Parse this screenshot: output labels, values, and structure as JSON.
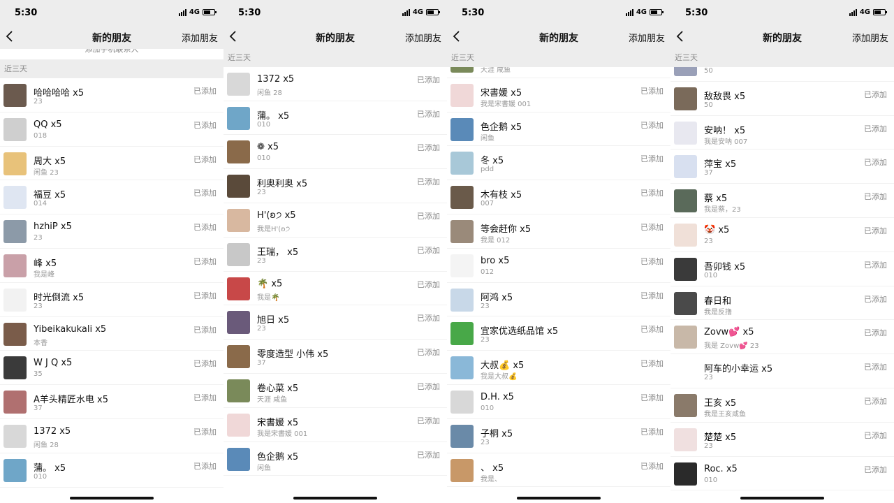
{
  "status_bar": {
    "time": "5:30",
    "network": "4G"
  },
  "nav": {
    "title": "新的朋友",
    "action": "添加朋友"
  },
  "section_label": "近三天",
  "phone_contacts_label": "添加手机联系人",
  "colors": {
    "background": "#ededed",
    "accent": "#07c160",
    "status_text": "#888888"
  },
  "icons": {
    "back": "chevron-left-icon",
    "phone": "phone-icon"
  },
  "panels": [
    {
      "show_phone_card": true,
      "show_sticky_header": false,
      "rows": [
        {
          "name": "哈哈哈哈  x5",
          "sub": "23",
          "status": "已添加",
          "avatar": "#6b5a4e"
        },
        {
          "name": "QQ  x5",
          "sub": "018",
          "status": "已添加",
          "avatar": "#cfcfcf"
        },
        {
          "name": "周大  x5",
          "sub": "闲鱼 23",
          "status": "已添加",
          "avatar": "#e8c27a"
        },
        {
          "name": "福豆  x5",
          "sub": "014",
          "status": "已添加",
          "avatar": "#dfe6f2"
        },
        {
          "name": "hzhiP x5",
          "sub": "23",
          "status": "已添加",
          "avatar": "#8c9aa8"
        },
        {
          "name": "峰 x5",
          "sub": "我是峰",
          "status": "已添加",
          "avatar": "#c9a0a8"
        },
        {
          "name": "时光倒流 x5",
          "sub": "23",
          "status": "已添加",
          "avatar": "#f2f2f2"
        },
        {
          "name": "Yibeikakukali x5",
          "sub": "本香",
          "status": "已添加",
          "avatar": "#7a5c4a"
        },
        {
          "name": "W J Q x5",
          "sub": "35",
          "status": "已添加",
          "avatar": "#3a3a3a"
        },
        {
          "name": "A羊头精匠水电  x5",
          "sub": "37",
          "status": "已添加",
          "avatar": "#b07070"
        },
        {
          "name": "1372  x5",
          "sub": "闲鱼 28",
          "status": "已添加",
          "avatar": "#d8d8d8"
        },
        {
          "name": "蒲。 x5",
          "sub": "010",
          "status": "已添加",
          "avatar": "#6fa6c8"
        }
      ]
    },
    {
      "show_phone_card": false,
      "show_sticky_header": true,
      "rows": [
        {
          "name": "A羊头精匠水电  x5",
          "sub": "37",
          "status": "已添加",
          "avatar": "#b07070"
        },
        {
          "name": "1372  x5",
          "sub": "闲鱼 28",
          "status": "已添加",
          "avatar": "#d8d8d8"
        },
        {
          "name": "蒲。 x5",
          "sub": "010",
          "status": "已添加",
          "avatar": "#6fa6c8"
        },
        {
          "name": "❁  x5",
          "sub": "010",
          "status": "已添加",
          "avatar": "#8a6a4a"
        },
        {
          "name": "利奥利奥 x5",
          "sub": "23",
          "status": "已添加",
          "avatar": "#5a4a3a"
        },
        {
          "name": "H'(ʚ੭ x5",
          "sub": "我是H'(ʚ੭",
          "status": "已添加",
          "avatar": "#d8b8a0"
        },
        {
          "name": "王瑞，  x5",
          "sub": "23",
          "status": "已添加",
          "avatar": "#c8c8c8"
        },
        {
          "name": "🌴 x5",
          "sub": "我是🌴",
          "status": "已添加",
          "avatar": "#c84848"
        },
        {
          "name": "旭日 x5",
          "sub": "23",
          "status": "已添加",
          "avatar": "#6a5a7a"
        },
        {
          "name": "零度造型   小伟 x5",
          "sub": "37",
          "status": "已添加",
          "avatar": "#8a6a4a"
        },
        {
          "name": "卷心菜 x5",
          "sub": "天涯 咸鱼",
          "status": "已添加",
          "avatar": "#7a8a5a"
        },
        {
          "name": "宋書媛 x5",
          "sub": "我是宋書媛 001",
          "status": "已添加",
          "avatar": "#f0d8d8"
        },
        {
          "name": "色企鹅 x5",
          "sub": "闲鱼",
          "status": "已添加",
          "avatar": "#5a8ab8"
        }
      ]
    },
    {
      "show_phone_card": false,
      "show_sticky_header": true,
      "rows": [
        {
          "name": "",
          "sub": "天涯 咸鱼",
          "status": "",
          "avatar": "#7a8a5a"
        },
        {
          "name": "宋書媛 x5",
          "sub": "我是宋書媛 001",
          "status": "已添加",
          "avatar": "#f0d8d8"
        },
        {
          "name": "色企鹅 x5",
          "sub": "闲鱼",
          "status": "已添加",
          "avatar": "#5a8ab8"
        },
        {
          "name": "冬 x5",
          "sub": "pdd",
          "status": "已添加",
          "avatar": "#a8c8d8"
        },
        {
          "name": "木有枝 x5",
          "sub": "007",
          "status": "已添加",
          "avatar": "#6a5a4a"
        },
        {
          "name": "等会赶你 x5",
          "sub": "我是 012",
          "status": "已添加",
          "avatar": "#9a8a7a"
        },
        {
          "name": "bro  x5",
          "sub": "012",
          "status": "已添加",
          "avatar": "#f4f4f4"
        },
        {
          "name": "阿鸿 x5",
          "sub": "23",
          "status": "已添加",
          "avatar": "#c8d8e8"
        },
        {
          "name": "宜家优选纸品馆  x5",
          "sub": "23",
          "status": "已添加",
          "avatar": "#48a848"
        },
        {
          "name": "大叔💰 x5",
          "sub": "我是大叔💰",
          "status": "已添加",
          "avatar": "#8ab8d8"
        },
        {
          "name": "D.H. x5",
          "sub": "010",
          "status": "已添加",
          "avatar": "#d8d8d8"
        },
        {
          "name": "子桐 x5",
          "sub": "23",
          "status": "已添加",
          "avatar": "#6a8aa8"
        },
        {
          "name": "、 x5",
          "sub": "我是、",
          "status": "已添加",
          "avatar": "#c89868"
        }
      ]
    },
    {
      "show_phone_card": false,
      "show_sticky_header": true,
      "rows": [
        {
          "name": "",
          "sub": "50",
          "status": "",
          "avatar": "#9aa0b8"
        },
        {
          "name": "敌敌畏 x5",
          "sub": "50",
          "status": "已添加",
          "avatar": "#7a6a5a"
        },
        {
          "name": "安呐！ x5",
          "sub": "我是安呐 007",
          "status": "已添加",
          "avatar": "#e8e8f0"
        },
        {
          "name": "萍宝 x5",
          "sub": "37",
          "status": "已添加",
          "avatar": "#d8e0f0"
        },
        {
          "name": "蔡  x5",
          "sub": "我是蔡，23",
          "status": "已添加",
          "avatar": "#5a6a5a"
        },
        {
          "name": "🤡 x5",
          "sub": "23",
          "status": "已添加",
          "avatar": "#f0e0d8"
        },
        {
          "name": "吾卯钱  x5",
          "sub": "010",
          "status": "已添加",
          "avatar": "#3a3a3a"
        },
        {
          "name": "春日和",
          "sub": "我是反撸",
          "status": "已添加",
          "avatar": "#4a4a4a"
        },
        {
          "name": "Zovw💕 x5",
          "sub": "我是 Zovw💕 23",
          "status": "已添加",
          "avatar": "#c8b8a8"
        },
        {
          "name": "阿车的小幸运  x5",
          "sub": "23",
          "status": "已添加",
          "avatar": "#ffffff"
        },
        {
          "name": "王亥  x5",
          "sub": "我是王亥咸鱼",
          "status": "已添加",
          "avatar": "#8a7a6a"
        },
        {
          "name": "楚楚 x5",
          "sub": "23",
          "status": "已添加",
          "avatar": "#f0e0e0"
        },
        {
          "name": "Roc.  x5",
          "sub": "010",
          "status": "已添加",
          "avatar": "#2a2a2a"
        }
      ]
    }
  ]
}
